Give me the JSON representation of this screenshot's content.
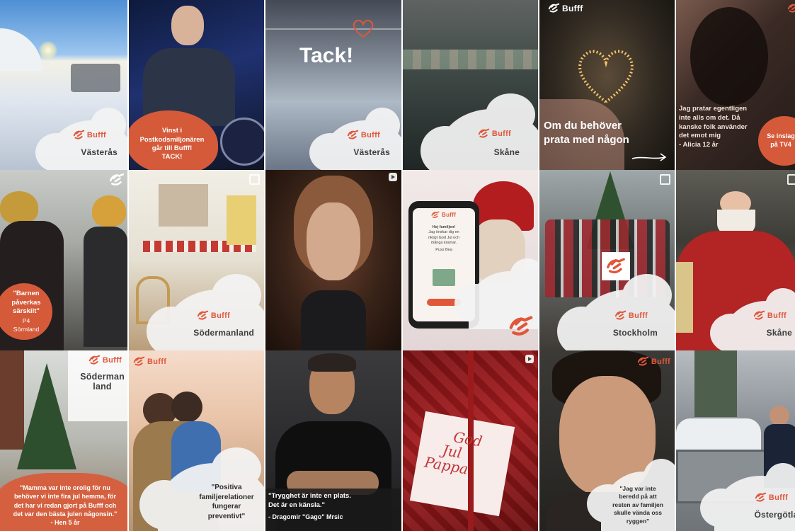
{
  "brand": {
    "name": "Bufff",
    "accent": "#e0573a",
    "blob_color": "#d45a3a"
  },
  "row1": {
    "t1": {
      "region": "Västerås"
    },
    "t2": {
      "caption_lines": [
        "Vinst i",
        "Postkodsmiljonären",
        "går till Bufff!",
        "TACK!"
      ]
    },
    "t3": {
      "headline": "Tack!",
      "region": "Västerås"
    },
    "t4": {
      "region": "Skåne"
    },
    "t5": {
      "caption_lines": [
        "Om du behöver",
        "prata med någon"
      ]
    },
    "t6": {
      "quote_lines": [
        "Jag pratar egentligen",
        "inte alls om det. Då",
        "kanske folk använder",
        "det emot mig",
        "- Alicia 12 år"
      ],
      "blob_lines": [
        "Se inslag",
        "på TV4"
      ]
    }
  },
  "row2": {
    "t1": {
      "blob_lines": [
        "\"Barnen",
        "påverkas",
        "särskilt\"",
        "P4",
        "Sörmland"
      ]
    },
    "t2": {
      "region": "Södermanland"
    },
    "t3": {},
    "t4": {
      "phone_lines": [
        "Hej familjen!",
        "Jag önskar dig en",
        "riktigt God Jul och",
        "många kramar.",
        "Puss Bea"
      ]
    },
    "t5": {
      "region": "Stockholm"
    },
    "t6": {
      "region": "Skåne"
    }
  },
  "row3": {
    "t1": {
      "region_lines": [
        "Söderman",
        "land"
      ],
      "quote_lines": [
        "\"Mamma var inte orolig för nu",
        "behöver vi inte fira jul hemma, för",
        "det har vi redan gjort på Bufff och",
        "det var den bästa julen någonsin.\"",
        "- Hen 5 år"
      ]
    },
    "t2": {
      "quote_lines": [
        "\"Positiva",
        "familjerelationer",
        "fungerar",
        "preventivt\""
      ]
    },
    "t3": {
      "quote_lines": [
        "\"Trygghet är inte en plats.",
        "Det är en känsla.\"",
        "- Dragomir \"Gago\" Mrsic"
      ]
    },
    "t4": {
      "card_lines": [
        "God",
        "Jul",
        "Pappa"
      ]
    },
    "t5": {
      "quote_lines": [
        "\"Jag var inte",
        "beredd på att",
        "resten av familjen",
        "skulle vända oss",
        "ryggen\""
      ]
    },
    "t6": {
      "region": "Östergötlan"
    }
  }
}
